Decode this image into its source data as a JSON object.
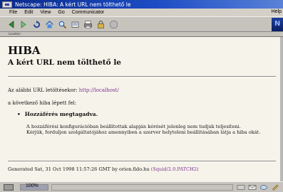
{
  "window": {
    "title": "Netscape: HIBA: A kért URL nem tölthető le"
  },
  "menu": {
    "items": [
      "File",
      "Edit",
      "View",
      "Go",
      "Communicator"
    ],
    "help": "Help"
  },
  "toolbar": {
    "buttons": [
      "back-icon",
      "forward-icon",
      "reload-icon",
      "home-icon",
      "search-icon",
      "guide-icon",
      "print-icon",
      "security-icon",
      "stop-icon"
    ],
    "location_label": "Location"
  },
  "page": {
    "heading": "HIBA",
    "subheading": "A kért URL nem tölthető le",
    "url_intro": "Az alábbi URL letöltésekor: ",
    "url_link": "http://localhost/",
    "error_intro": "a következő hiba lépett fel:",
    "error_title": "Hozzáférés megtagadva.",
    "error_desc_1": "A hozzáférési konfigurációban beállítottak alapján kérését jelenleg nem tudjuk teljesíteni.",
    "error_desc_2": "Kérjük, forduljon szolgáltatójához amennyiben a szerver helyteleni beállításában látja a hiba okát.",
    "footer_text": "Generated Sat, 31 Oct 1998 11:57:26 GMT by orion.fido.hu ",
    "footer_link": "(Squid/2.0.PATCH2)"
  },
  "status": {
    "progress_text": "100%",
    "progress_value": 1.0
  },
  "colors": {
    "link": "#7a2e8c",
    "titlebar": "#1c4cc4",
    "page_bg": "#f6f4ea"
  }
}
